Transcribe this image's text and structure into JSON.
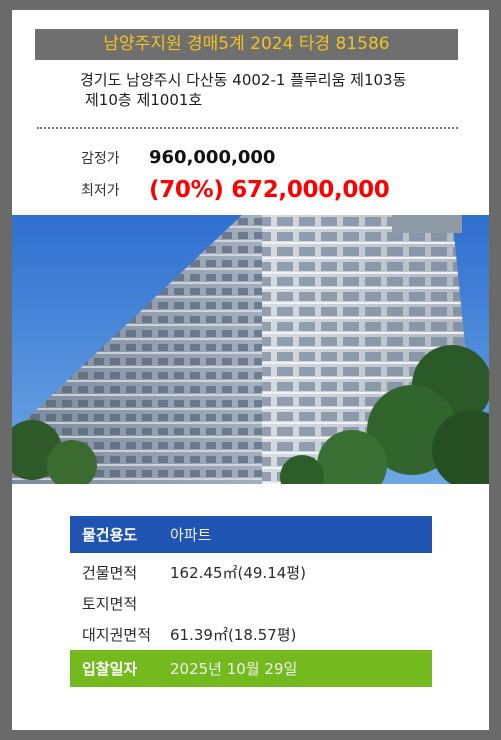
{
  "header": {
    "title": "남양주지원 경매5계 2024 타경 81586"
  },
  "address": {
    "line1": "경기도 남양주시 다산동 4002-1 플루리움 제103동",
    "line2": "제10층 제1001호"
  },
  "prices": {
    "appraisal_label": "감정가",
    "appraisal_value": "960,000,000",
    "minimum_label": "최저가",
    "minimum_value": "(70%) 672,000,000"
  },
  "details": [
    {
      "label": "물건용도",
      "value": "아파트"
    },
    {
      "label": "건물면적",
      "value": "162.45㎡(49.14평)"
    },
    {
      "label": "토지면적",
      "value": ""
    },
    {
      "label": "대지권면적",
      "value": "61.39㎡(18.57평)"
    },
    {
      "label": "입찰일자",
      "value": "2025년 10월 29일"
    }
  ],
  "colors": {
    "title_bg": "#6f6f6f",
    "title_text": "#f2c31f",
    "minimum_price": "#ff0000",
    "row_blue": "#2054b3",
    "row_green": "#74ba1e"
  }
}
